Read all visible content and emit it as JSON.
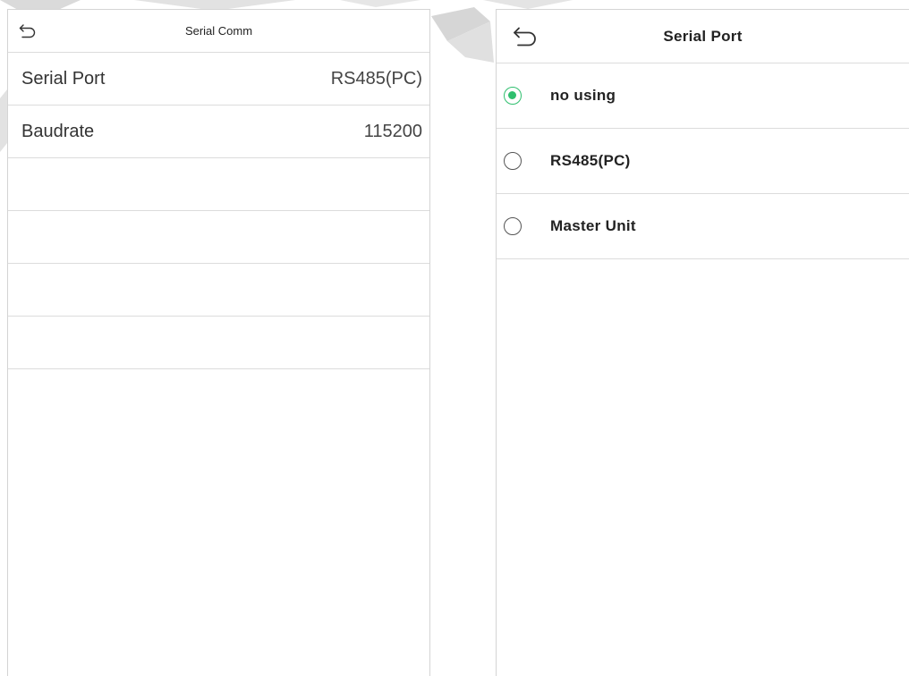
{
  "colors": {
    "accent": "#2fbf6e",
    "divider": "#dcdcdc",
    "backdrop": "#d8d8d8"
  },
  "left_screen": {
    "back_icon": "back-arrow-icon",
    "title": "Serial Comm",
    "rows": [
      {
        "label": "Serial Port",
        "value": "RS485(PC)"
      },
      {
        "label": "Baudrate",
        "value": "115200"
      },
      {
        "label": "",
        "value": ""
      },
      {
        "label": "",
        "value": ""
      },
      {
        "label": "",
        "value": ""
      },
      {
        "label": "",
        "value": ""
      }
    ]
  },
  "right_screen": {
    "back_icon": "back-arrow-icon",
    "title": "Serial Port",
    "options": [
      {
        "label": "no using",
        "selected": true
      },
      {
        "label": "RS485(PC)",
        "selected": false
      },
      {
        "label": "Master Unit",
        "selected": false
      }
    ]
  }
}
